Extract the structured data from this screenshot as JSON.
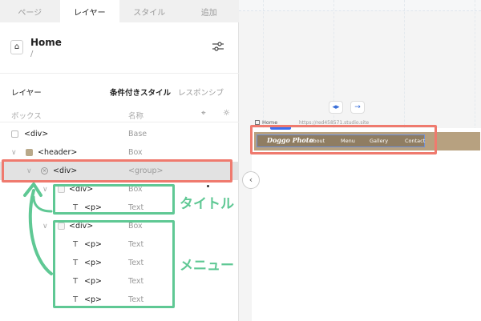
{
  "tabs": [
    {
      "label": "ページ",
      "active": false
    },
    {
      "label": "レイヤー",
      "active": true
    },
    {
      "label": "スタイル",
      "active": false
    },
    {
      "label": "追加",
      "active": false
    }
  ],
  "page": {
    "title": "Home",
    "path": "/"
  },
  "layer_tabs": {
    "layer": "レイヤー",
    "conditional": "条件付きスタイル",
    "responsive": "レスポンシブ"
  },
  "columns": {
    "box": "ボックス",
    "name": "名称"
  },
  "layers": [
    {
      "name": "<div>",
      "type": "Base"
    },
    {
      "name": "<header>",
      "type": "Box"
    },
    {
      "name": "<div>",
      "type": "<group>",
      "selected": true
    },
    {
      "name": "<div>",
      "type": "Box"
    },
    {
      "name": "<p>",
      "type": "Text"
    },
    {
      "name": "<div>",
      "type": "Box"
    },
    {
      "name": "<p>",
      "type": "Text"
    },
    {
      "name": "<p>",
      "type": "Text"
    },
    {
      "name": "<p>",
      "type": "Text"
    },
    {
      "name": "<p>",
      "type": "Text"
    }
  ],
  "canvas": {
    "frame_label": "Home",
    "url": "https://red458571.studio.site",
    "logo": "Doggo Photo",
    "menu": [
      "About",
      "Menu",
      "Gallery",
      "Contact"
    ],
    "header_color": "#b7a180"
  },
  "annotations": {
    "title_label": "タイトル",
    "menu_label": "メニュー",
    "highlight_red": "#ef7a6e",
    "highlight_green": "#5fc894"
  },
  "icons": {
    "home": "home-icon",
    "settings": "sliders-icon",
    "collapse": "chevron-left-icon"
  }
}
